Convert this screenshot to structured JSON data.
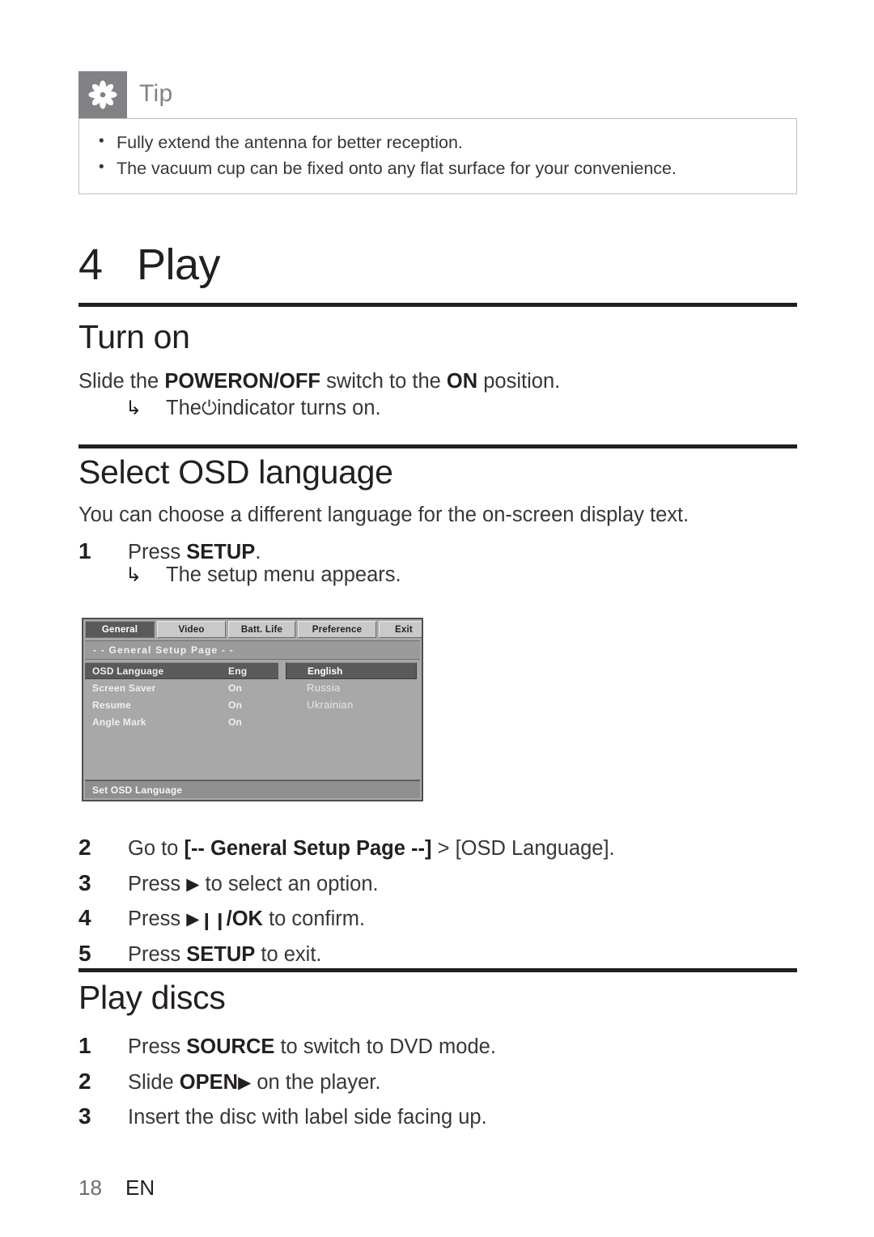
{
  "tip": {
    "icon": "asterisk-flower-icon",
    "label": "Tip",
    "items": [
      "Fully extend the antenna for better reception.",
      "The vacuum cup can be fixed onto any flat surface for your convenience."
    ],
    "bullet": "•",
    "icon_bg": "#808285",
    "label_color": "#808285",
    "border_color": "#bcbec0"
  },
  "chapter": {
    "number": "4",
    "title": "Play"
  },
  "sections": {
    "turn_on": {
      "heading": "Turn on",
      "paragraph_prefix": "Slide the ",
      "paragraph_bold1": "POWERON/OFF",
      "paragraph_mid": " switch to the ",
      "paragraph_bold2": "ON",
      "paragraph_suffix": " position.",
      "arrow": "↳",
      "result_prefix": "The ",
      "result_symbol": "⏻",
      "result_suffix": " indicator turns on."
    },
    "osd_language": {
      "heading": "Select OSD language",
      "intro": "You can choose a different language for the on-screen display text.",
      "step1_num": "1",
      "step1_text_prefix": "Press ",
      "step1_text_bold": "SETUP",
      "step1_text_suffix": ".",
      "arrow": "↳",
      "step1_result": "The setup menu appears.",
      "steps": [
        {
          "num": "2",
          "prefix": "Go to ",
          "bold": "[-- General Setup Page --]",
          "mid": " > ",
          "bold2": "[OSD Language]",
          "suffix": "."
        },
        {
          "num": "3",
          "prefix": "Press ",
          "glyph": "▶",
          "suffix": " to select an option."
        },
        {
          "num": "4",
          "prefix": "Press ",
          "glyph": "▶",
          "glyph2": "❙❙",
          "bold": "/OK",
          "suffix": " to confirm."
        },
        {
          "num": "5",
          "prefix": "Press ",
          "bold": "SETUP",
          "suffix": " to exit."
        }
      ]
    },
    "play_discs": {
      "heading": "Play discs",
      "steps": [
        {
          "num": "1",
          "prefix": "Press ",
          "bold": "SOURCE",
          "suffix": " to switch to DVD mode."
        },
        {
          "num": "2",
          "prefix": "Slide ",
          "bold": "OPEN",
          "glyph": "▶",
          "suffix": " on the player."
        },
        {
          "num": "3",
          "prefix": "Insert the disc with label side facing up.",
          "bold": "",
          "suffix": ""
        }
      ]
    }
  },
  "osd_screen": {
    "tabs": [
      {
        "label": "General",
        "selected": true
      },
      {
        "label": "Video",
        "selected": false
      },
      {
        "label": "Batt. Life",
        "selected": false
      },
      {
        "label": "Preference",
        "selected": false
      },
      {
        "label": "Exit",
        "selected": false
      }
    ],
    "page_title": "- -   General Setup Page   - -",
    "settings": [
      {
        "label": "OSD Language",
        "value": "Eng",
        "highlighted": true
      },
      {
        "label": "Screen Saver",
        "value": "On",
        "highlighted": false
      },
      {
        "label": "Resume",
        "value": "On",
        "highlighted": false
      },
      {
        "label": "Angle Mark",
        "value": "On",
        "highlighted": false
      }
    ],
    "options": [
      {
        "label": "English",
        "selected": true
      },
      {
        "label": "Russia",
        "selected": false
      },
      {
        "label": "Ukrainian",
        "selected": false
      }
    ],
    "status_bar": "Set OSD Language",
    "bg_color": "#a8a8a8",
    "highlight_color": "#5a5a5a",
    "tab_color": "#c9c9c9"
  },
  "footer": {
    "page_number": "18",
    "language_code": "EN"
  }
}
